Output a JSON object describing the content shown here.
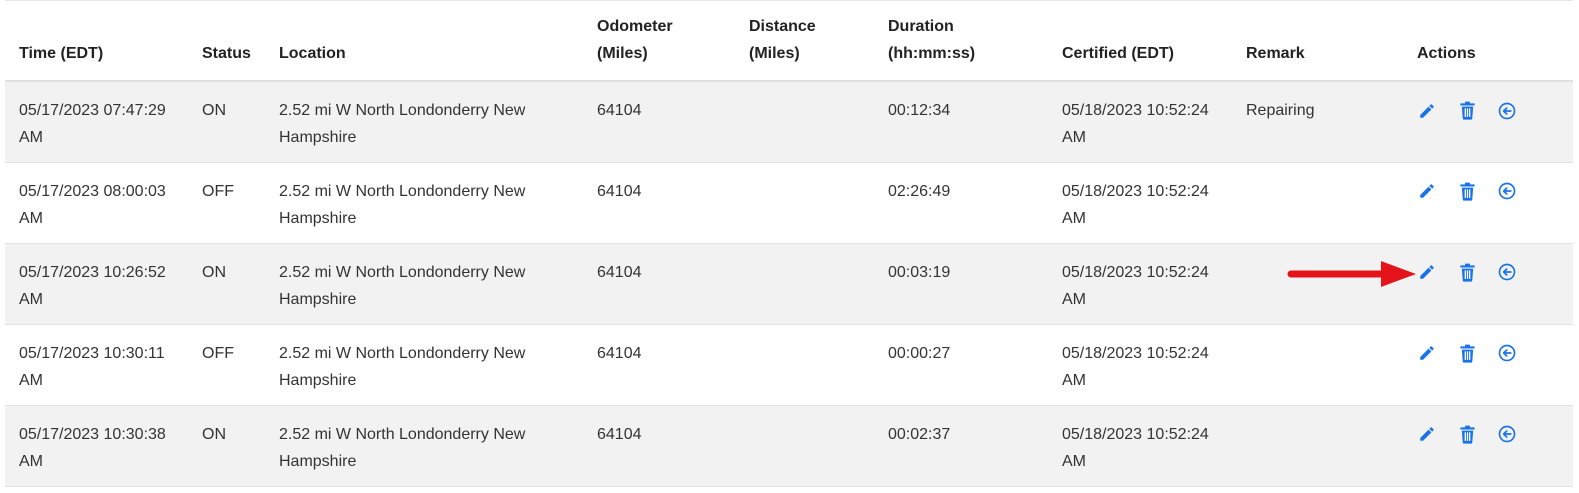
{
  "colors": {
    "accent": "#1a73e8",
    "row_shaded": "#f2f2f2",
    "annotation_arrow": "#e5141b"
  },
  "table": {
    "headers": {
      "time": "Time (EDT)",
      "status": "Status",
      "location": "Location",
      "odometer_line1": "Odometer",
      "odometer_line2": "(Miles)",
      "distance_line1": "Distance",
      "distance_line2": "(Miles)",
      "duration_line1": "Duration",
      "duration_line2": "(hh:mm:ss)",
      "certified": "Certified (EDT)",
      "remark": "Remark",
      "actions": "Actions"
    },
    "rows": [
      {
        "time": "05/17/2023 07:47:29 AM",
        "status": "ON",
        "location": "2.52 mi W North Londonderry New Hampshire",
        "odometer": "64104",
        "distance": "",
        "duration": "00:12:34",
        "certified": "05/18/2023 10:52:24 AM",
        "remark": "Repairing"
      },
      {
        "time": "05/17/2023 08:00:03 AM",
        "status": "OFF",
        "location": "2.52 mi W North Londonderry New Hampshire",
        "odometer": "64104",
        "distance": "",
        "duration": "02:26:49",
        "certified": "05/18/2023 10:52:24 AM",
        "remark": ""
      },
      {
        "time": "05/17/2023 10:26:52 AM",
        "status": "ON",
        "location": "2.52 mi W North Londonderry New Hampshire",
        "odometer": "64104",
        "distance": "",
        "duration": "00:03:19",
        "certified": "05/18/2023 10:52:24 AM",
        "remark": ""
      },
      {
        "time": "05/17/2023 10:30:11 AM",
        "status": "OFF",
        "location": "2.52 mi W North Londonderry New Hampshire",
        "odometer": "64104",
        "distance": "",
        "duration": "00:00:27",
        "certified": "05/18/2023 10:52:24 AM",
        "remark": ""
      },
      {
        "time": "05/17/2023 10:30:38 AM",
        "status": "ON",
        "location": "2.52 mi W North Londonderry New Hampshire",
        "odometer": "64104",
        "distance": "",
        "duration": "00:02:37",
        "certified": "05/18/2023 10:52:24 AM",
        "remark": ""
      }
    ],
    "row_actions": [
      "pencil-icon",
      "trash-icon",
      "circle-arrow-left-icon"
    ]
  }
}
